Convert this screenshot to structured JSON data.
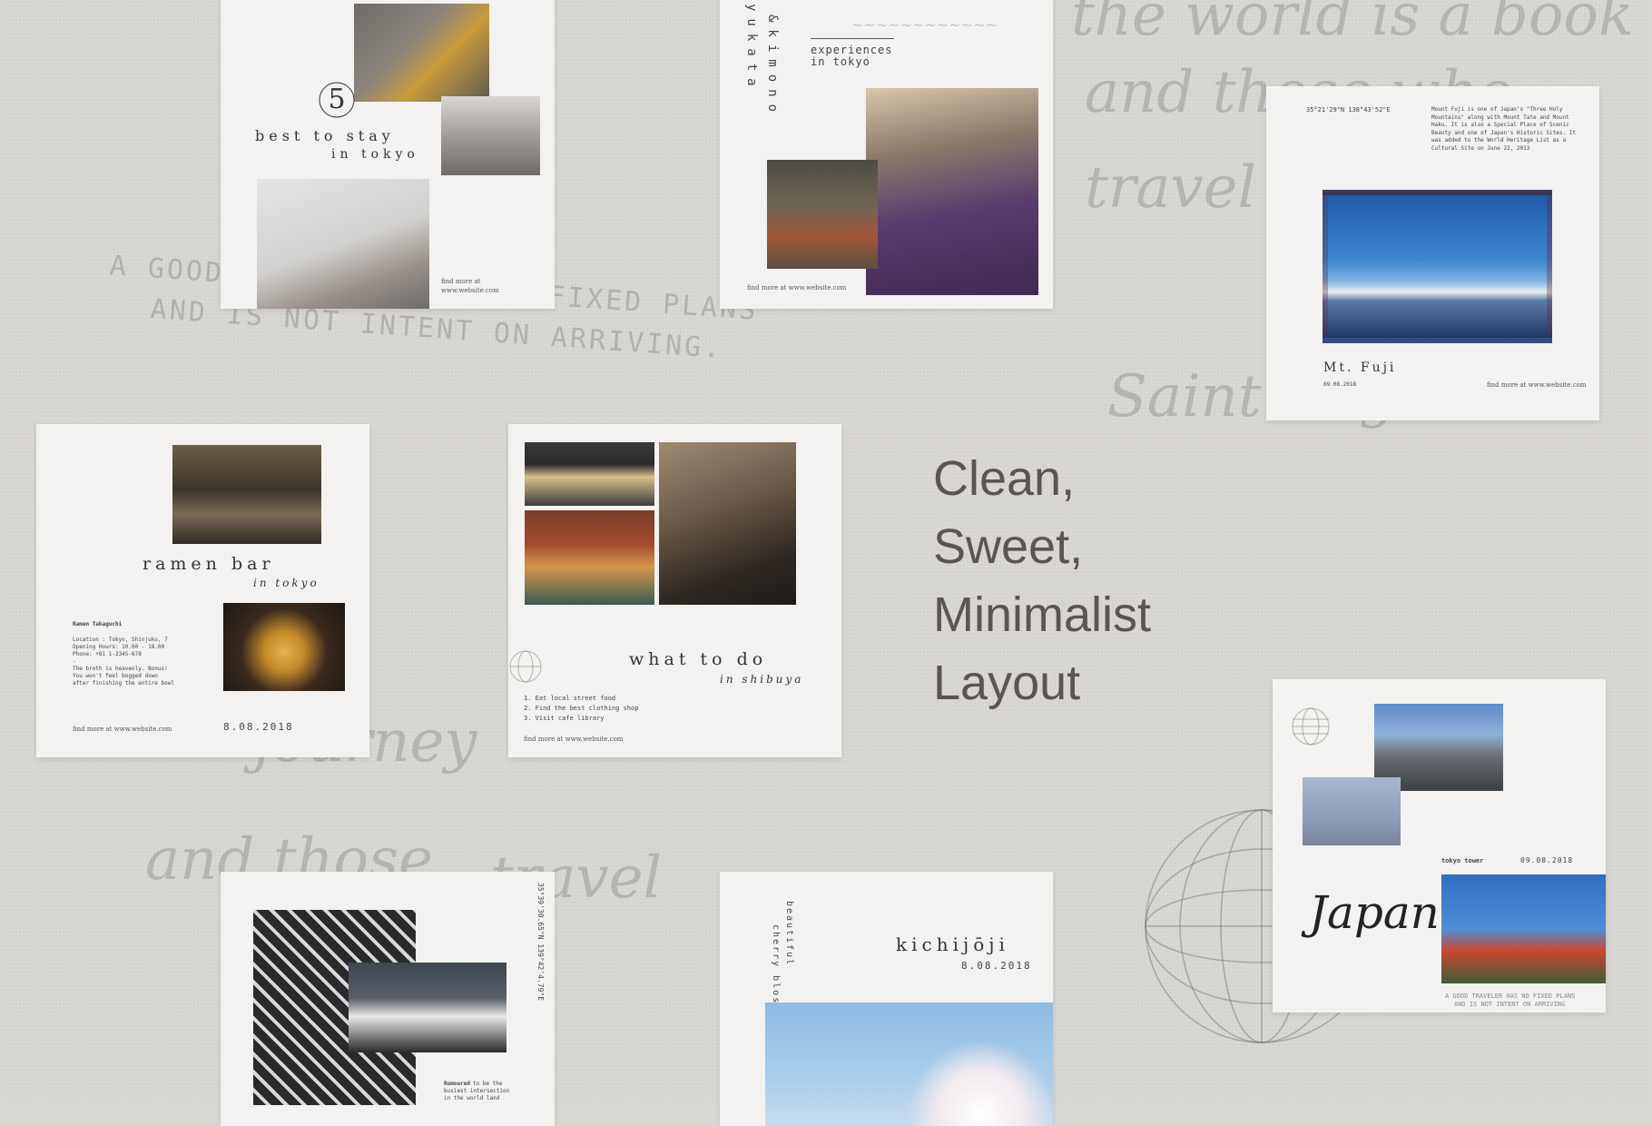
{
  "background": {
    "typewriter_line1": "A GOOD TRAVELER HAS NO FIXED PLANS",
    "typewriter_line2": "AND IS NOT INTENT ON ARRIVING.",
    "script_words": [
      "the world is a book",
      "and those who",
      "travel",
      "Saint Augustine",
      "journey",
      "and those",
      "travel"
    ]
  },
  "headline": {
    "line1": "Clean,",
    "line2": "Sweet,",
    "line3": "Minimalist",
    "line4": "Layout"
  },
  "card_stay": {
    "number": "5",
    "title": "best to stay",
    "subtitle": "in tokyo",
    "find_more": "find more at",
    "website": "www.website.com"
  },
  "card_kimono": {
    "vertical1": "yukata",
    "vertical2": "&kimono",
    "title": "experiences",
    "subtitle": "in tokyo",
    "find_more": "find more at www.website.com"
  },
  "card_fuji": {
    "coords": "35°21'29\"N 138°43'52\"E",
    "description": "Mount Fuji is one of Japan's \"Three Holy Mountains\" along with Mount Tate and Mount Haku. It is also a Special Place of Scenic Beauty and one of Japan's Historic Sites. It was added to the World Heritage List as a Cultural Site on June 22, 2013",
    "title": "Mt. Fuji",
    "date": "09.08.2018",
    "find_more": "find more at www.website.com"
  },
  "card_ramen": {
    "title": "ramen bar",
    "subtitle": "in tokyo",
    "name": "Ramen Takaguchi",
    "location": "Location : Tokyo, Shinjuku, 7",
    "hours": "Opening Hours: 10.00 - 18.00",
    "phone": "Phone: +81 1-2345-678",
    "dash": "-",
    "note1": "The broth is heavenly. Bonus!",
    "note2": "You won't feel bogged down",
    "note3": "after finishing the entire bowl",
    "find_more": "find more at www.website.com",
    "date": "8.08.2018"
  },
  "card_todo": {
    "title": "what to do",
    "subtitle": "in shibuya",
    "list": [
      "1. Eat local street food",
      "2. Find the best clothing shop",
      "3. Visit cafe library"
    ],
    "find_more": "find more at www.website.com"
  },
  "card_japan": {
    "label": "tokyo tower",
    "date": "09.08.2018",
    "script": "Japan",
    "footer1": "A GOOD TRAVELER HAS NO FIXED PLANS",
    "footer2": "AND IS NOT INTENT ON ARRIVING"
  },
  "card_crossing": {
    "coords": "35°39'30.65\"N 139°42'4.79\"E",
    "caption_bold": "Rumoured",
    "caption1": "to be the",
    "caption2": "busiest intersection",
    "caption3": "in the world land"
  },
  "card_kichijoji": {
    "vertical1": "beautiful",
    "vertical2": "cherry blossom",
    "title": "kichijōji",
    "date": "8.08.2018"
  },
  "colors": {
    "background": "#d9d7d4",
    "card": "#f3f2f0",
    "headline": "#5a554e"
  }
}
